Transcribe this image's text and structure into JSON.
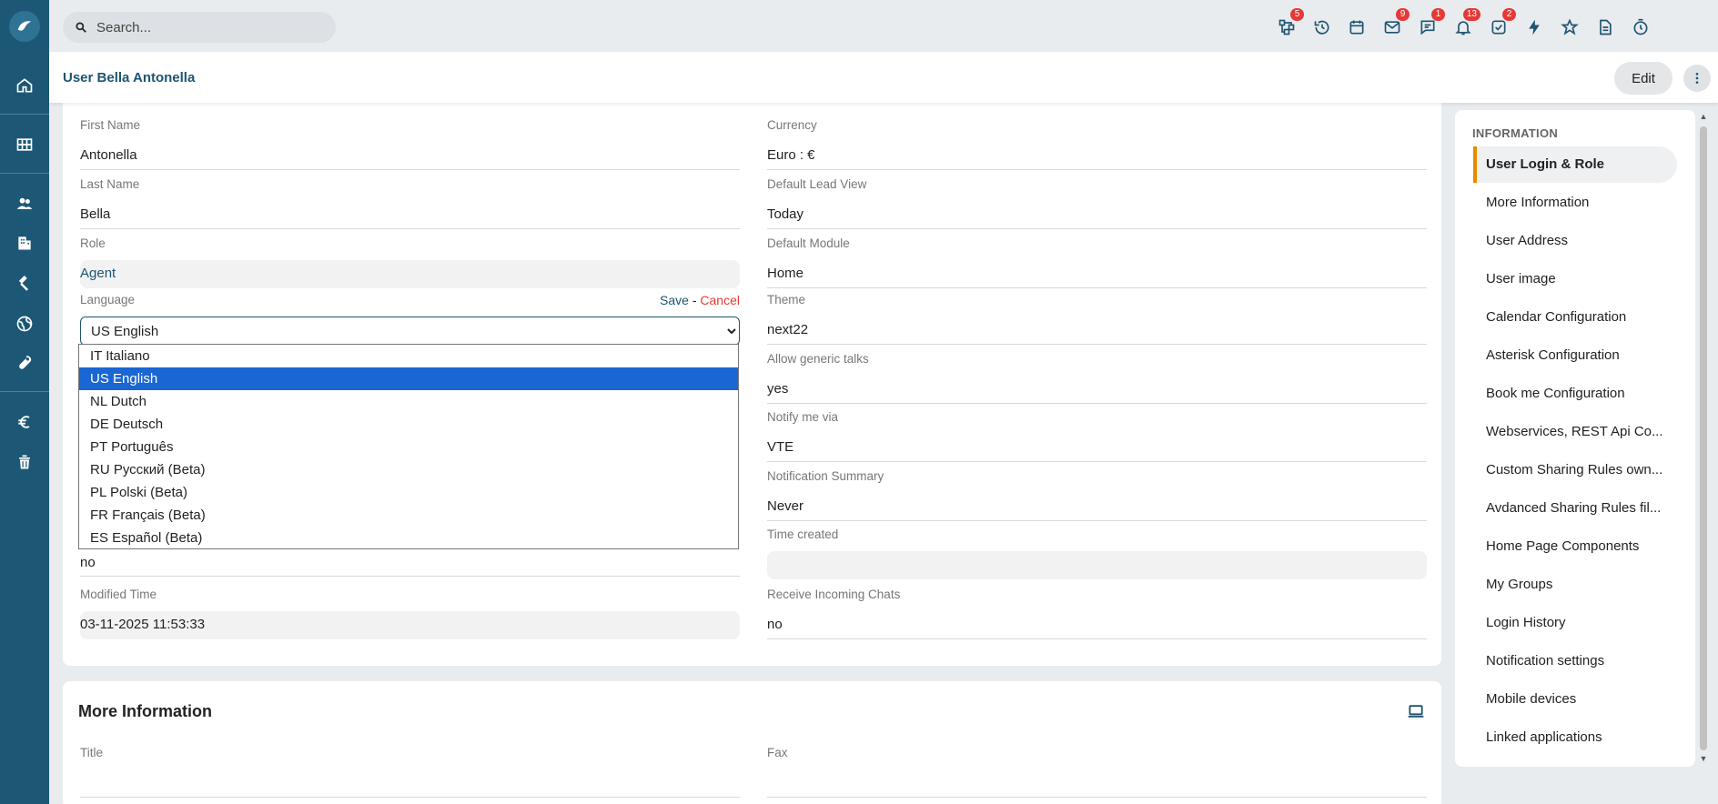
{
  "search": {
    "placeholder": "Search..."
  },
  "topbar": {
    "badges": {
      "processes": "5",
      "mail": "9",
      "chat": "1",
      "notifications": "13",
      "tasks": "2"
    }
  },
  "header": {
    "title": "User Bella Antonella",
    "edit_label": "Edit"
  },
  "form": {
    "first_name": {
      "label": "First Name",
      "value": "Antonella"
    },
    "last_name": {
      "label": "Last Name",
      "value": "Bella"
    },
    "role": {
      "label": "Role",
      "value": "Agent"
    },
    "language": {
      "label": "Language",
      "save": "Save",
      "sep": "-",
      "cancel": "Cancel",
      "selected": "US English",
      "options": [
        "IT Italiano",
        "US English",
        "NL Dutch",
        "DE Deutsch",
        "PT Português",
        "RU Русский (Beta)",
        "PL Polski (Beta)",
        "FR Français (Beta)",
        "ES Español (Beta)"
      ]
    },
    "hidden_value": "no",
    "modified_time": {
      "label": "Modified Time",
      "value": "03-11-2025 11:53:33"
    },
    "currency": {
      "label": "Currency",
      "value": "Euro : €"
    },
    "default_lead_view": {
      "label": "Default Lead View",
      "value": "Today"
    },
    "default_module": {
      "label": "Default Module",
      "value": "Home"
    },
    "theme": {
      "label": "Theme",
      "value": "next22"
    },
    "allow_generic_talks": {
      "label": "Allow generic talks",
      "value": "yes"
    },
    "notify_me_via": {
      "label": "Notify me via",
      "value": "VTE"
    },
    "notification_summary": {
      "label": "Notification Summary",
      "value": "Never"
    },
    "time_created": {
      "label": "Time created",
      "value": ""
    },
    "receive_incoming_chats": {
      "label": "Receive Incoming Chats",
      "value": "no"
    }
  },
  "more_info": {
    "title": "More Information",
    "title_field": {
      "label": "Title",
      "value": ""
    },
    "fax": {
      "label": "Fax",
      "value": ""
    }
  },
  "rnav": {
    "header": "INFORMATION",
    "items": [
      "User Login & Role",
      "More Information",
      "User Address",
      "User image",
      "Calendar Configuration",
      "Asterisk Configuration",
      "Book me Configuration",
      "Webservices, REST Api Co...",
      "Custom Sharing Rules own...",
      "Avdanced Sharing Rules fil...",
      "Home Page Components",
      "My Groups",
      "Login History",
      "Notification settings",
      "Mobile devices",
      "Linked applications"
    ]
  }
}
